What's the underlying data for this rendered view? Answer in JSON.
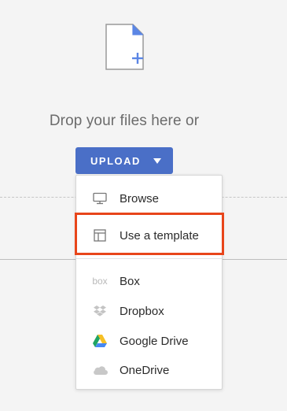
{
  "drop_zone": {
    "icon": "file-plus-icon",
    "text": "Drop your files here or"
  },
  "upload_button": {
    "label": "UPLOAD",
    "icon": "caret-down-icon",
    "color": "#4a6fc7"
  },
  "menu": {
    "items": [
      {
        "label": "Browse",
        "icon": "monitor-icon"
      },
      {
        "label": "Use a template",
        "icon": "template-icon",
        "highlighted": true
      },
      {
        "label": "Box",
        "icon": "box-icon",
        "icon_text": "box"
      },
      {
        "label": "Dropbox",
        "icon": "dropbox-icon"
      },
      {
        "label": "Google Drive",
        "icon": "google-drive-icon"
      },
      {
        "label": "OneDrive",
        "icon": "onedrive-icon"
      }
    ]
  },
  "colors": {
    "highlight": "#e8451a",
    "accent": "#4a6fc7"
  }
}
